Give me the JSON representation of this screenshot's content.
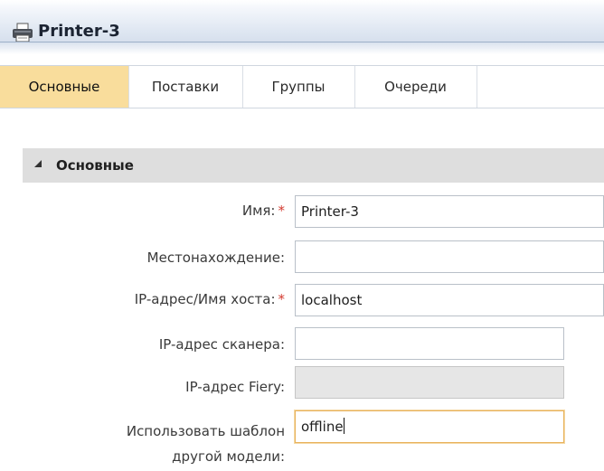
{
  "window": {
    "title": "Printer-3",
    "icon": "printer-icon"
  },
  "tabs": [
    {
      "label": "Основные",
      "active": true
    },
    {
      "label": "Поставки",
      "active": false
    },
    {
      "label": "Группы",
      "active": false
    },
    {
      "label": "Очереди",
      "active": false
    }
  ],
  "section": {
    "title": "Основные",
    "expanded": true
  },
  "form": {
    "name": {
      "label": "Имя:",
      "required": "*",
      "value": "Printer-3"
    },
    "location": {
      "label": "Местонахождение:",
      "value": ""
    },
    "host": {
      "label": "IP-адрес/Имя хоста:",
      "required": "*",
      "value": "localhost"
    },
    "scanner_ip": {
      "label": "IP-адрес сканера:",
      "value": ""
    },
    "fiery_ip": {
      "label": "IP-адрес Fiery:",
      "value": "",
      "disabled": true
    },
    "template": {
      "label_line1": "Использовать шаблон",
      "label_line2": "другой модели:",
      "value": "offline",
      "focused": true
    }
  },
  "colors": {
    "active_tab": "#f9dd9c",
    "required_mark": "#d33a2f",
    "focus_border": "#e8b25b",
    "section_bg": "#dedede"
  }
}
